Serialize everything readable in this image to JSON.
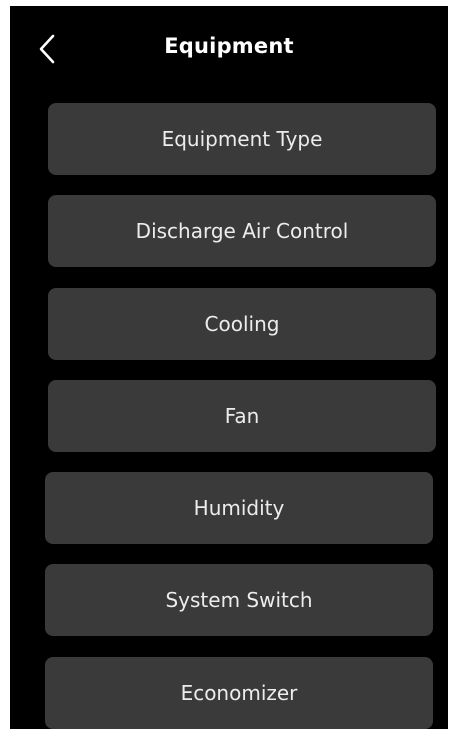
{
  "header": {
    "title": "Equipment",
    "back_icon": "chevron-left-icon"
  },
  "menu": {
    "items": [
      {
        "label": "Equipment Type"
      },
      {
        "label": "Discharge Air Control"
      },
      {
        "label": "Cooling"
      },
      {
        "label": "Fan"
      },
      {
        "label": "Humidity"
      },
      {
        "label": "System Switch"
      },
      {
        "label": "Economizer"
      }
    ]
  },
  "colors": {
    "background": "#000000",
    "button": "#3a3a3a",
    "text": "#ffffff"
  }
}
